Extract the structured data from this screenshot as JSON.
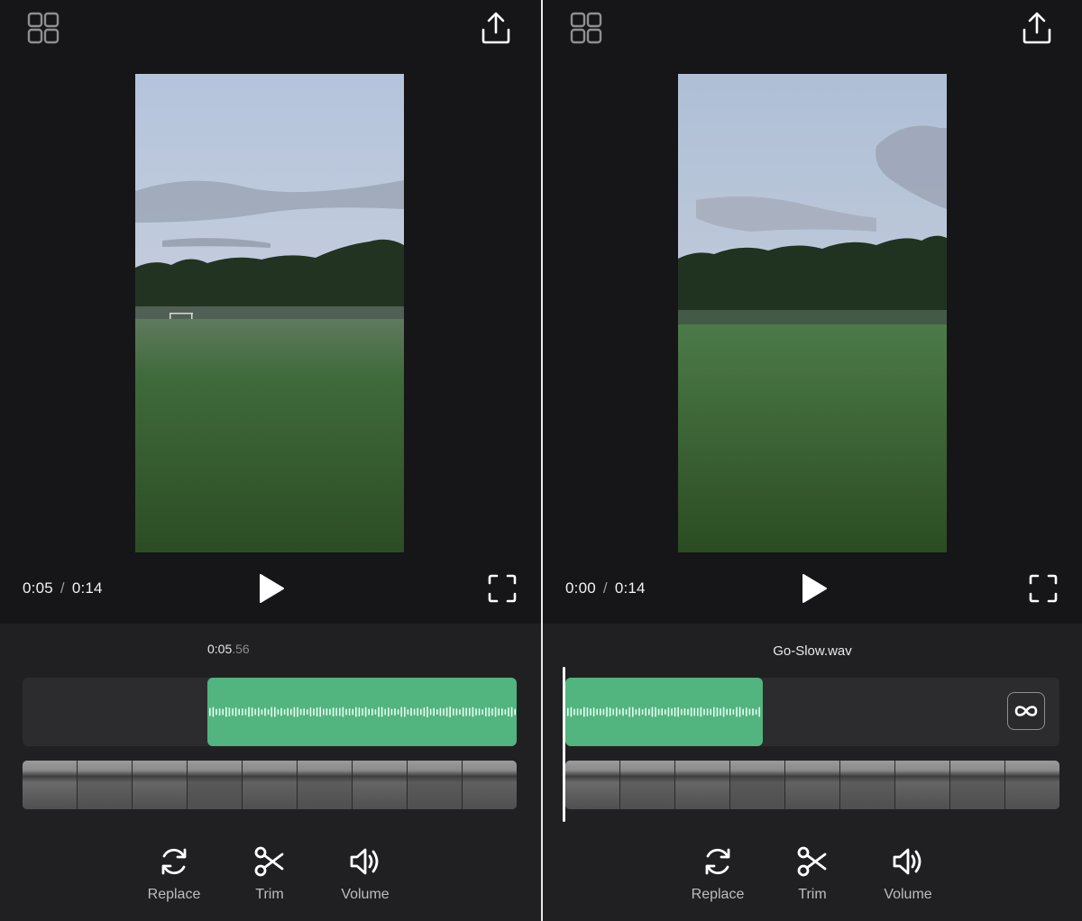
{
  "left_panel": {
    "time": {
      "current": "0:05",
      "separator": "/",
      "total": "0:14"
    },
    "editor": {
      "timestamp_main": "0:05",
      "timestamp_fraction": ".56"
    },
    "tools": [
      {
        "label": "Replace",
        "icon": "replace-icon"
      },
      {
        "label": "Trim",
        "icon": "scissors-icon"
      },
      {
        "label": "Volume",
        "icon": "speaker-icon"
      }
    ]
  },
  "right_panel": {
    "time": {
      "current": "0:00",
      "separator": "/",
      "total": "0:14"
    },
    "editor": {
      "audio_file": "Go-Slow.wav"
    },
    "tools": [
      {
        "label": "Replace",
        "icon": "replace-icon"
      },
      {
        "label": "Trim",
        "icon": "scissors-icon"
      },
      {
        "label": "Volume",
        "icon": "speaker-icon"
      }
    ]
  },
  "colors": {
    "background": "#161618",
    "editor_background": "#202022",
    "audio_clip": "#52b47f",
    "track": "#2c2c2e"
  }
}
